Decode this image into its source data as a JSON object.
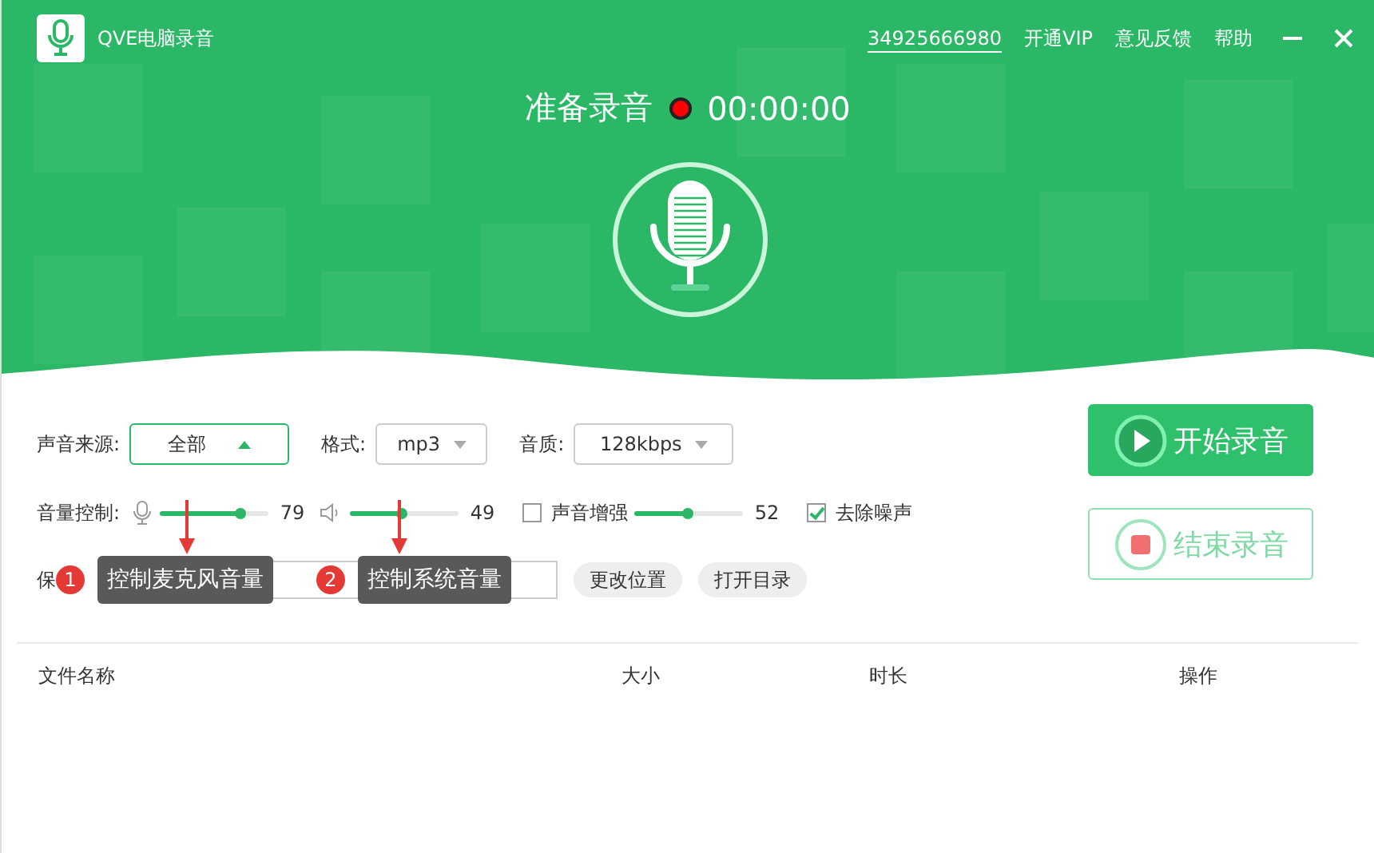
{
  "window": {
    "title": "QVE电脑录音",
    "account": "34925666980",
    "links": [
      "开通VIP",
      "意见反馈",
      "帮助"
    ]
  },
  "status": {
    "label": "准备录音",
    "time": "00:00:00"
  },
  "source": {
    "label": "声音来源:",
    "value": "全部",
    "open": true
  },
  "format": {
    "label": "格式:",
    "value": "mp3"
  },
  "quality": {
    "label": "音质:",
    "value": "128kbps"
  },
  "volume": {
    "label": "音量控制:",
    "mic": {
      "level": 0.75,
      "reading": "79"
    },
    "system": {
      "level": 0.49,
      "reading": "49"
    }
  },
  "enhance": {
    "label": "声音增强",
    "checked": false,
    "level": 0.5,
    "reading": "52"
  },
  "denoise": {
    "label": "去除噪声",
    "checked": true
  },
  "save": {
    "label": "保",
    "buttons": [
      "更改位置",
      "打开目录"
    ]
  },
  "actions": [
    {
      "label": "开始录音",
      "kind": "start"
    },
    {
      "label": "结束录音",
      "kind": "stop"
    }
  ],
  "table": {
    "columns": [
      "文件名称",
      "大小",
      "时长",
      "操作"
    ]
  },
  "callouts": [
    {
      "number": "1",
      "text": "控制麦克风音量"
    },
    {
      "number": "2",
      "text": "控制系统音量"
    }
  ]
}
